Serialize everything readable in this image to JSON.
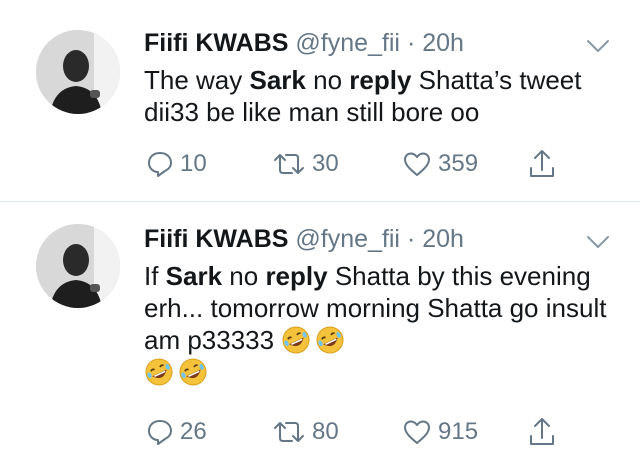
{
  "tweets": [
    {
      "author_name": "Fiifi KWABS",
      "handle": "@fyne_fii",
      "separator": "·",
      "time": "20h",
      "text_parts": [
        "The way ",
        "Sark",
        " no ",
        "reply",
        " Shatta’s tweet dii33 be like man still bore oo"
      ],
      "emoji": [],
      "replies": "10",
      "retweets": "30",
      "likes": "359"
    },
    {
      "author_name": "Fiifi KWABS",
      "handle": "@fyne_fii",
      "separator": "·",
      "time": "20h",
      "text_parts": [
        "If ",
        "Sark",
        " no ",
        "reply",
        " Shatta by this evening erh... tomorrow morning Shatta go insult am p33333 "
      ],
      "emoji": [
        "rolling-on-floor-laughing",
        "rolling-on-floor-laughing",
        "rolling-on-floor-laughing",
        "rolling-on-floor-laughing"
      ],
      "replies": "26",
      "retweets": "80",
      "likes": "915"
    }
  ],
  "icons": {
    "reply": "reply-icon",
    "retweet": "retweet-icon",
    "like": "heart-icon",
    "share": "share-icon",
    "menu": "chevron-down-icon"
  },
  "colors": {
    "text": "#14171a",
    "secondary": "#657786",
    "divider": "#e1e8ed",
    "emoji_face": "#f5c33b"
  }
}
